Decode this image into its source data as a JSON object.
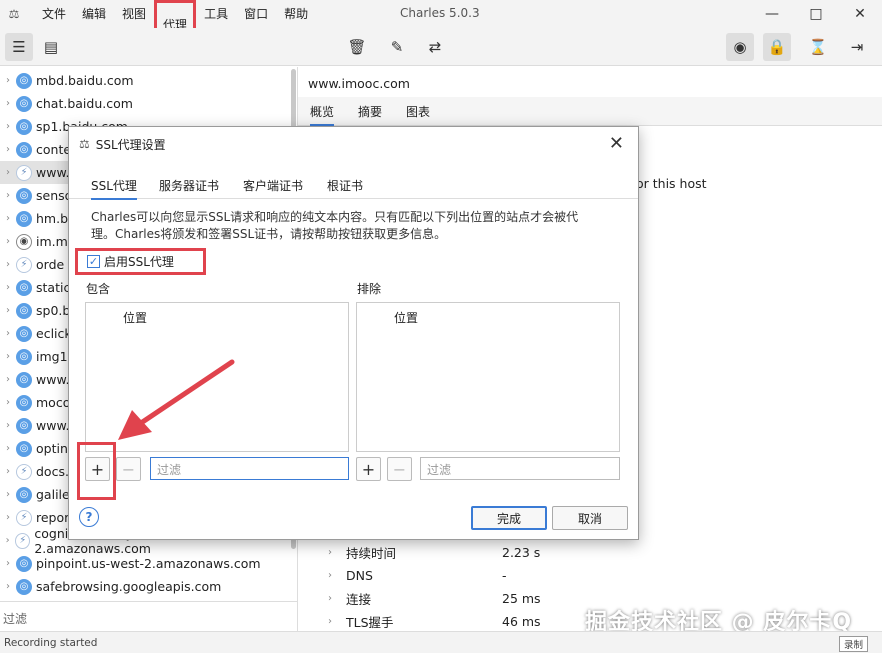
{
  "app": {
    "title": "Charles 5.0.3",
    "menu": [
      "文件",
      "编辑",
      "视图",
      "代理",
      "工具",
      "窗口",
      "帮助"
    ]
  },
  "hosts": [
    {
      "name": "mbd.baidu.com",
      "icon": "globe"
    },
    {
      "name": "chat.baidu.com",
      "icon": "globe"
    },
    {
      "name": "sp1.baidu.com",
      "icon": "globe"
    },
    {
      "name": "conte",
      "icon": "globe"
    },
    {
      "name": "www.",
      "icon": "bolt",
      "selected": true
    },
    {
      "name": "senso",
      "icon": "globe"
    },
    {
      "name": "hm.b",
      "icon": "globe"
    },
    {
      "name": "im.mi",
      "icon": "eye"
    },
    {
      "name": "orde",
      "icon": "bolt"
    },
    {
      "name": "static",
      "icon": "globe"
    },
    {
      "name": "sp0.b",
      "icon": "globe"
    },
    {
      "name": "eclick",
      "icon": "globe"
    },
    {
      "name": "img1",
      "icon": "globe"
    },
    {
      "name": "www.",
      "icon": "globe"
    },
    {
      "name": "moco",
      "icon": "globe"
    },
    {
      "name": "www.",
      "icon": "globe"
    },
    {
      "name": "optin",
      "icon": "globe"
    },
    {
      "name": "docs.",
      "icon": "bolt"
    },
    {
      "name": "galile",
      "icon": "globe"
    },
    {
      "name": "repor",
      "icon": "bolt"
    },
    {
      "name": "cognito-identity.us-west-2.amazonaws.com",
      "icon": "bolt"
    },
    {
      "name": "pinpoint.us-west-2.amazonaws.com",
      "icon": "globe"
    },
    {
      "name": "safebrowsing.googleapis.com",
      "icon": "globe"
    }
  ],
  "left_filter_label": "过滤",
  "right": {
    "host": "www.imooc.com",
    "tabs": [
      "概览",
      "摘要",
      "图表"
    ],
    "note": "or this host",
    "rows": [
      {
        "key": "持续时间",
        "value": "2.23 s"
      },
      {
        "key": "DNS",
        "value": "-"
      },
      {
        "key": "连接",
        "value": "25 ms"
      },
      {
        "key": "TLS握手",
        "value": "46 ms"
      }
    ]
  },
  "watermark": "掘金技术社区 @ 皮尔卡Q",
  "status": {
    "text": "Recording started",
    "button": "录制"
  },
  "dialog": {
    "title": "SSL代理设置",
    "tabs": [
      "SSL代理",
      "服务器证书",
      "客户端证书",
      "根证书"
    ],
    "description": "Charles可以向您显示SSL请求和响应的纯文本内容。只有匹配以下列出位置的站点才会被代理。Charles将颁发和签署SSL证书，请按帮助按钮获取更多信息。",
    "enable_label": "启用SSL代理",
    "include_label": "包含",
    "exclude_label": "排除",
    "column_header": "位置",
    "filter_placeholder": "过滤",
    "ok_label": "完成",
    "cancel_label": "取消"
  }
}
